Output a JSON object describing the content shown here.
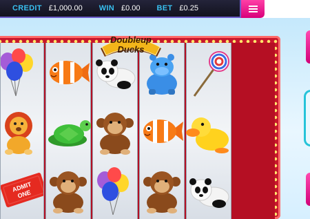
{
  "hud": {
    "credit_label": "CREDIT",
    "credit_value": "£1,000.00",
    "win_label": "WIN",
    "win_value": "£0.00",
    "bet_label": "BET",
    "bet_value": "£0.25"
  },
  "menu": {
    "icon": "hamburger-menu-icon"
  },
  "logo": {
    "line1": "Doubleup",
    "line2": "Ducks"
  },
  "ticket": {
    "line1": "ADMIT",
    "line2": "ONE"
  },
  "reels": [
    [
      "balloons",
      "lion",
      "ticket"
    ],
    [
      "clownfish",
      "turtle",
      "monkey"
    ],
    [
      "panda",
      "monkey",
      "balloons"
    ],
    [
      "hippo",
      "clownfish",
      "monkey"
    ],
    [
      "lollipop",
      "duck",
      "panda"
    ]
  ],
  "colors": {
    "accent_pink": "#e0148a",
    "frame_red": "#c8172c",
    "hud_label_blue": "#39c0f0",
    "side_teal": "#25c3d9"
  }
}
